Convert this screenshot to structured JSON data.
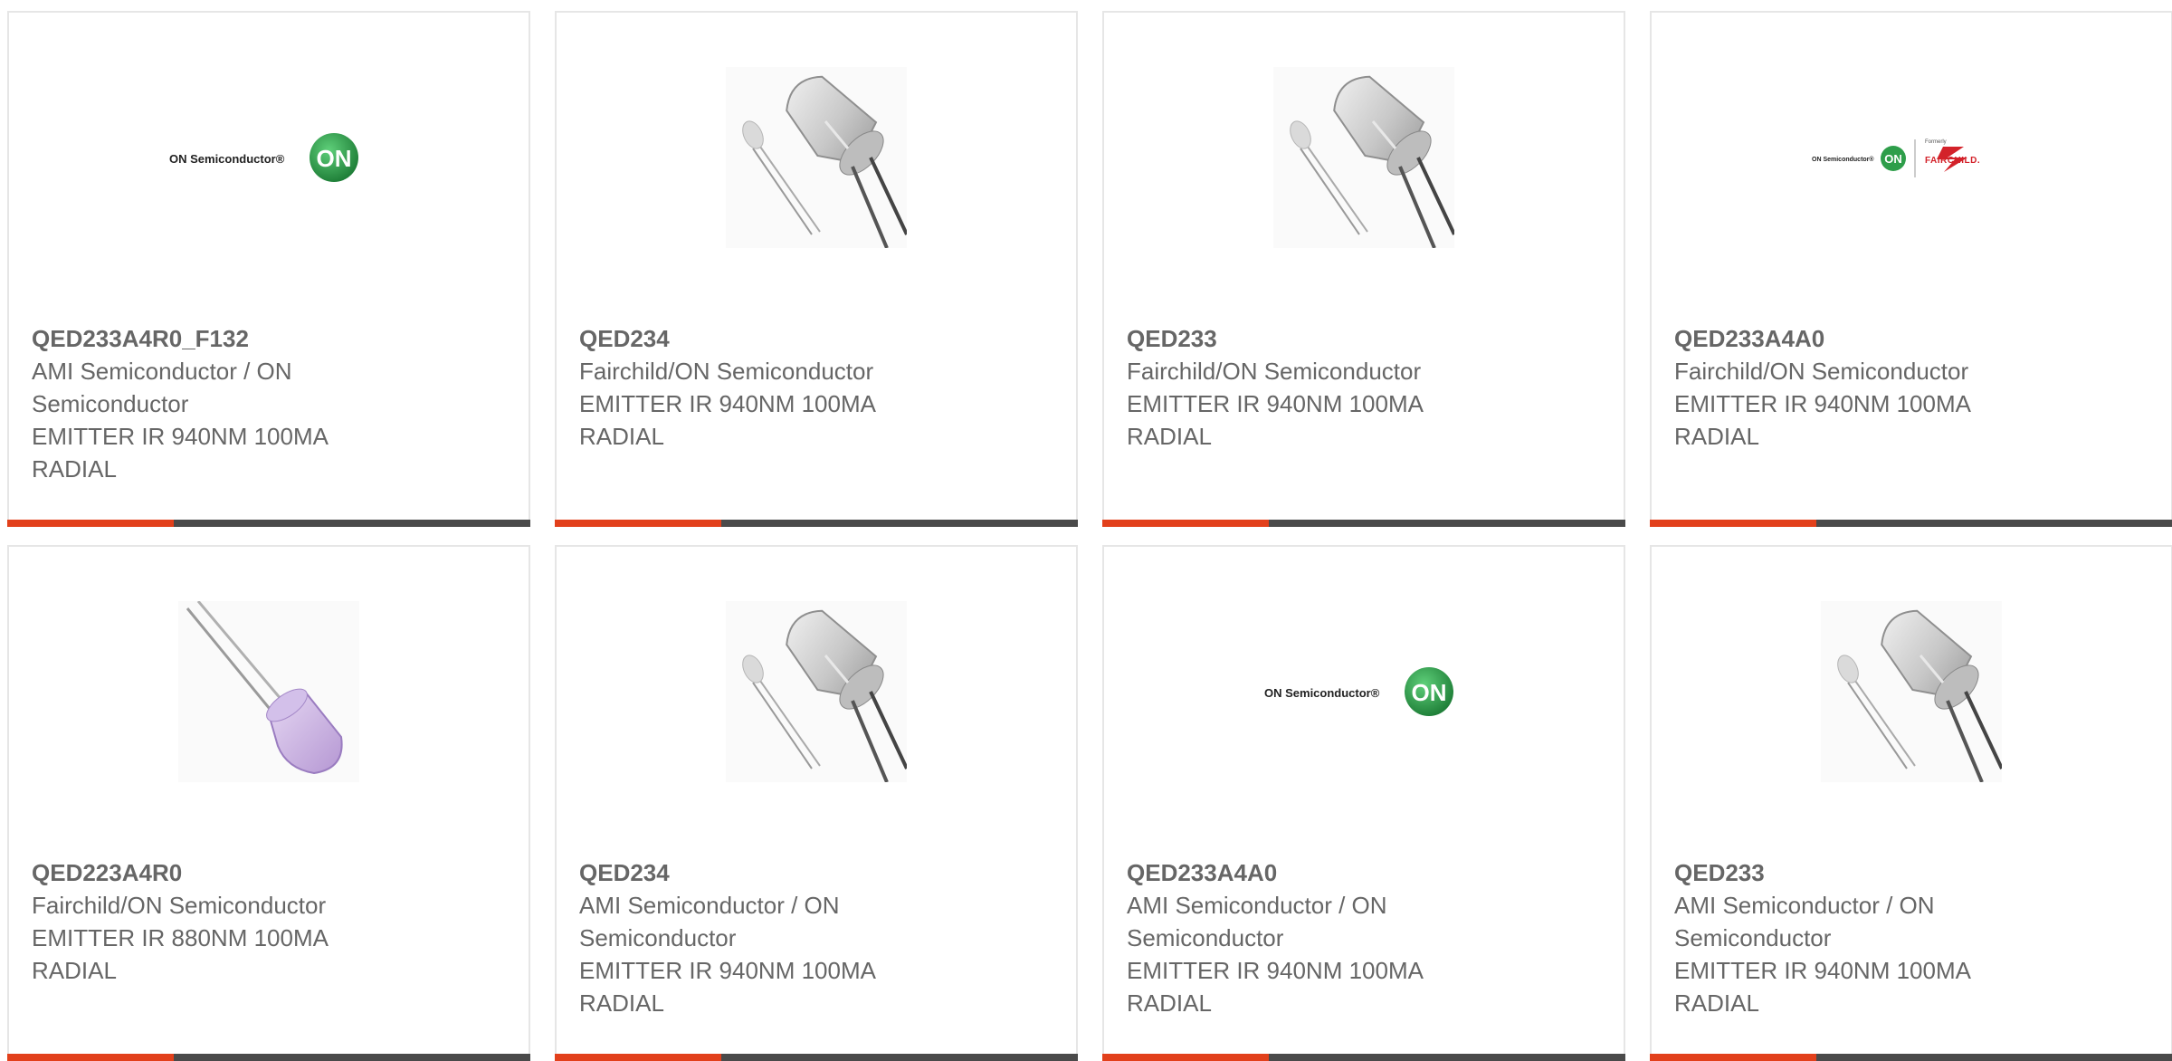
{
  "colors": {
    "accent": "#e2401b",
    "bar": "#4a4a4a",
    "text": "#666666",
    "on_green": "#2e9e4a",
    "fairchild_red": "#d3222a"
  },
  "products": [
    {
      "part": "QED233A4R0_F132",
      "maker_line1": "AMI Semiconductor / ON",
      "maker_line2": "Semiconductor",
      "desc_line1": "EMITTER IR 940NM 100MA",
      "desc_line2": "RADIAL",
      "image": "on-semiconductor-logo",
      "logo_text": "ON Semiconductor®",
      "logo_mark": "ON"
    },
    {
      "part": "QED234",
      "maker_line1": "Fairchild/ON Semiconductor",
      "maker_line2": "",
      "desc_line1": "EMITTER IR 940NM 100MA",
      "desc_line2": "RADIAL",
      "image": "clear-led-photo"
    },
    {
      "part": "QED233",
      "maker_line1": "Fairchild/ON Semiconductor",
      "maker_line2": "",
      "desc_line1": "EMITTER IR 940NM 100MA",
      "desc_line2": "RADIAL",
      "image": "clear-led-photo"
    },
    {
      "part": "QED233A4A0",
      "maker_line1": "Fairchild/ON Semiconductor",
      "maker_line2": "",
      "desc_line1": "EMITTER IR 940NM 100MA",
      "desc_line2": "RADIAL",
      "image": "on-fairchild-logo",
      "logo_text": "ON Semiconductor®",
      "logo_mark": "ON",
      "logo_formerly": "Formerly",
      "logo_fairchild": "FAIRCHILD."
    },
    {
      "part": "QED223A4R0",
      "maker_line1": "Fairchild/ON Semiconductor",
      "maker_line2": "",
      "desc_line1": "EMITTER IR 880NM 100MA",
      "desc_line2": "RADIAL",
      "image": "purple-led-photo"
    },
    {
      "part": "QED234",
      "maker_line1": "AMI Semiconductor / ON",
      "maker_line2": "Semiconductor",
      "desc_line1": "EMITTER IR 940NM 100MA",
      "desc_line2": "RADIAL",
      "image": "clear-led-photo"
    },
    {
      "part": "QED233A4A0",
      "maker_line1": "AMI Semiconductor / ON",
      "maker_line2": "Semiconductor",
      "desc_line1": "EMITTER IR 940NM 100MA",
      "desc_line2": "RADIAL",
      "image": "on-semiconductor-logo",
      "logo_text": "ON Semiconductor®",
      "logo_mark": "ON"
    },
    {
      "part": "QED233",
      "maker_line1": "AMI Semiconductor / ON",
      "maker_line2": "Semiconductor",
      "desc_line1": "EMITTER IR 940NM 100MA",
      "desc_line2": "RADIAL",
      "image": "clear-led-photo"
    }
  ]
}
